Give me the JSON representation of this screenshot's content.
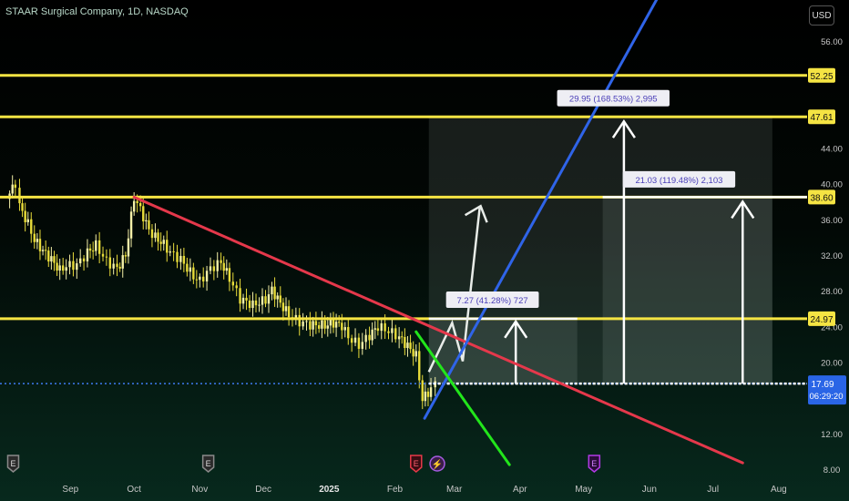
{
  "header": {
    "title": "STAAR Surgical Company, 1D, NASDAQ",
    "currency": "USD"
  },
  "colors": {
    "yellow": "#f5e443",
    "red": "#e5384b",
    "blue": "#2f64e8",
    "green": "#22e51b",
    "candle_up": "#f4f0a8",
    "candle_down": "#e8dc3a"
  },
  "chart_data": {
    "type": "candlestick",
    "title": "STAAR Surgical Company, 1D, NASDAQ",
    "x": {
      "labels": [
        "Sep",
        "Oct",
        "Nov",
        "Dec",
        "2025",
        "Feb",
        "Mar",
        "Apr",
        "May",
        "Jun",
        "Jul",
        "Aug"
      ]
    },
    "y": {
      "ticks": [
        "56.00",
        "44.00",
        "40.00",
        "36.00",
        "32.00",
        "28.00",
        "24.00",
        "20.00",
        "12.00",
        "8.00"
      ],
      "ylim": [
        8,
        60
      ]
    },
    "price_levels": [
      {
        "label": "52.25",
        "value": 52.25
      },
      {
        "label": "47.61",
        "value": 47.61
      },
      {
        "label": "38.60",
        "value": 38.6
      },
      {
        "label": "24.97",
        "value": 24.97
      }
    ],
    "current_price": {
      "label": "17.69",
      "value": 17.69,
      "countdown": "06:29:20"
    },
    "close_path": [
      [
        "2024-08-02",
        38.4
      ],
      [
        "2024-08-06",
        40.2
      ],
      [
        "2024-08-08",
        37.6
      ],
      [
        "2024-08-12",
        35.6
      ],
      [
        "2024-08-15",
        33.8
      ],
      [
        "2024-08-19",
        32.6
      ],
      [
        "2024-08-23",
        31.6
      ],
      [
        "2024-08-27",
        30.4
      ],
      [
        "2024-08-30",
        30.9
      ],
      [
        "2024-09-04",
        31.0
      ],
      [
        "2024-09-09",
        32.4
      ],
      [
        "2024-09-13",
        33.2
      ],
      [
        "2024-09-18",
        31.4
      ],
      [
        "2024-09-23",
        30.6
      ],
      [
        "2024-09-27",
        32.1
      ],
      [
        "2024-10-01",
        38.6
      ],
      [
        "2024-10-04",
        37.2
      ],
      [
        "2024-10-08",
        34.9
      ],
      [
        "2024-10-11",
        34.1
      ],
      [
        "2024-10-15",
        33.3
      ],
      [
        "2024-10-18",
        32.4
      ],
      [
        "2024-10-23",
        31.6
      ],
      [
        "2024-10-29",
        29.7
      ],
      [
        "2024-11-01",
        29.2
      ],
      [
        "2024-11-06",
        30.6
      ],
      [
        "2024-11-11",
        31.3
      ],
      [
        "2024-11-15",
        29.5
      ],
      [
        "2024-11-20",
        27.2
      ],
      [
        "2024-11-26",
        26.5
      ],
      [
        "2024-12-02",
        27.1
      ],
      [
        "2024-12-05",
        28.2
      ],
      [
        "2024-12-09",
        26.7
      ],
      [
        "2024-12-13",
        25.4
      ],
      [
        "2024-12-18",
        24.6
      ],
      [
        "2024-12-23",
        24.3
      ],
      [
        "2024-12-30",
        24.2
      ],
      [
        "2025-01-03",
        24.5
      ],
      [
        "2025-01-07",
        24.2
      ],
      [
        "2025-01-10",
        22.9
      ],
      [
        "2025-01-15",
        22.0
      ],
      [
        "2025-01-20",
        23.1
      ],
      [
        "2025-01-24",
        24.1
      ],
      [
        "2025-01-29",
        23.6
      ],
      [
        "2025-02-03",
        22.9
      ],
      [
        "2025-02-07",
        21.9
      ],
      [
        "2025-02-11",
        20.8
      ],
      [
        "2025-02-14",
        15.9
      ],
      [
        "2025-02-18",
        17.1
      ],
      [
        "2025-02-20",
        17.69
      ]
    ],
    "trendlines": [
      {
        "color": "red",
        "from": [
          "2024-10-01",
          38.6
        ],
        "to": [
          "2025-07-15",
          8.8
        ]
      },
      {
        "color": "blue",
        "from": [
          "2025-02-15",
          13.8
        ],
        "to": [
          "2025-06-05",
          61.0
        ]
      },
      {
        "color": "green",
        "from": [
          "2025-02-11",
          23.5
        ],
        "to": [
          "2025-03-27",
          8.6
        ]
      }
    ],
    "zones": [
      {
        "from": [
          "2025-02-17",
          47.61
        ],
        "to": [
          "2025-07-29",
          17.69
        ]
      },
      {
        "from": [
          "2025-02-17",
          24.97
        ],
        "to": [
          "2025-04-28",
          17.69
        ]
      },
      {
        "from": [
          "2025-05-10",
          38.6
        ],
        "to": [
          "2025-07-29",
          17.69
        ]
      }
    ],
    "measures": [
      {
        "label": "7.27 (41.28%) 727",
        "at": [
          "2025-03-30",
          24.97
        ],
        "box": [
          "2025-03-19",
          27.0
        ]
      },
      {
        "label": "29.95 (168.53%) 2,995",
        "at": [
          "2025-05-20",
          47.61
        ],
        "box": [
          "2025-05-15",
          49.6
        ]
      },
      {
        "label": "21.03 (119.48%) 2,103",
        "at": [
          "2025-07-15",
          38.6
        ],
        "box": [
          "2025-06-15",
          40.5
        ]
      }
    ],
    "projection": [
      [
        "2025-02-17",
        19.0
      ],
      [
        "2025-02-28",
        24.5
      ],
      [
        "2025-03-05",
        20.2
      ],
      [
        "2025-03-13",
        37.4
      ]
    ],
    "event_markers": [
      {
        "text": "E",
        "date": "2024-08-05",
        "kind": "earnings"
      },
      {
        "text": "E",
        "date": "2024-11-05",
        "kind": "earnings"
      },
      {
        "text": "E",
        "date": "2025-02-11",
        "kind": "earnings-red"
      },
      {
        "text": "⚡",
        "date": "2025-02-21",
        "kind": "news"
      },
      {
        "text": "E",
        "date": "2025-05-06",
        "kind": "earnings-purple"
      }
    ]
  }
}
